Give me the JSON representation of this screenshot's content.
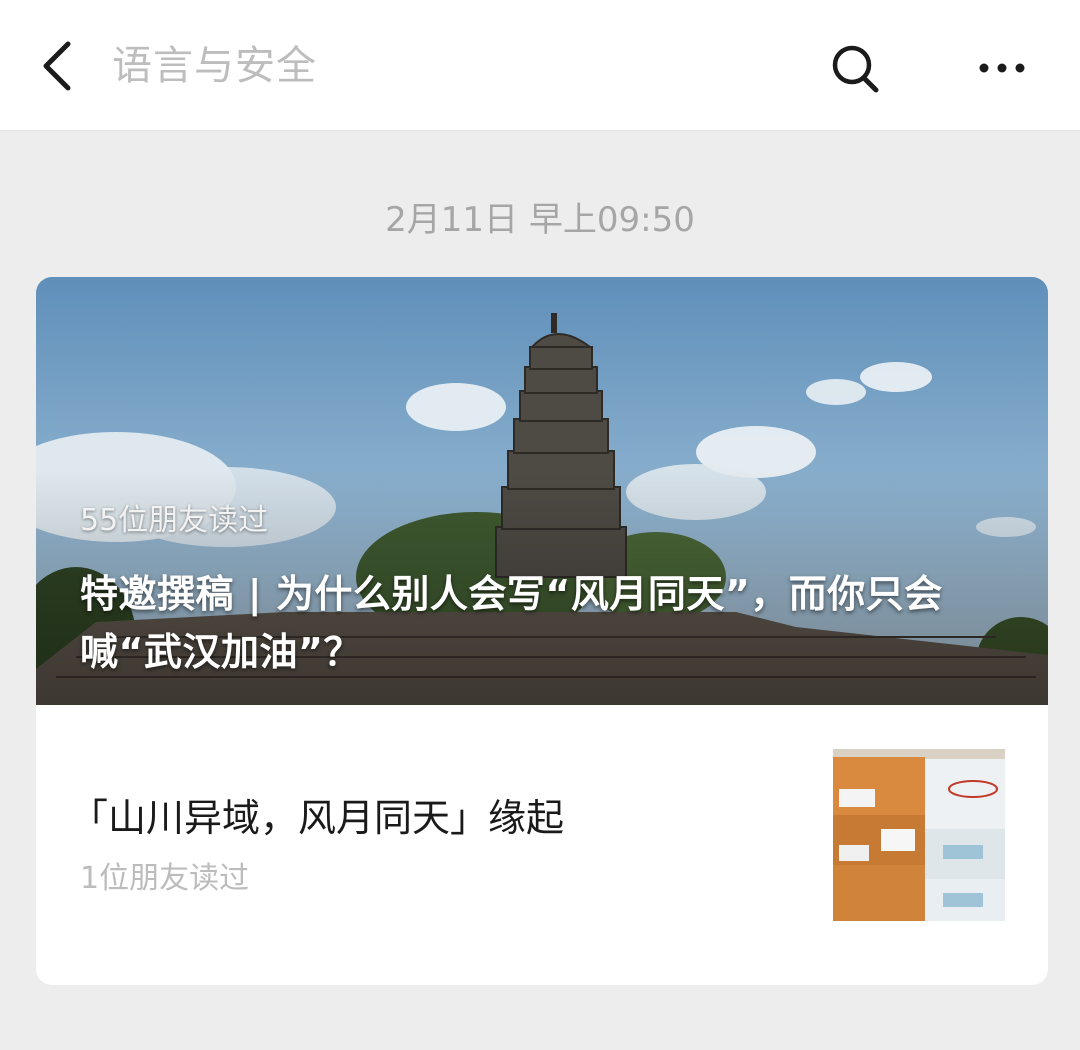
{
  "header": {
    "title": "语言与安全"
  },
  "message": {
    "timestamp": "2月11日 早上09:50"
  },
  "articles": [
    {
      "read_count": "55位朋友读过",
      "title": "特邀撰稿 | 为什么别人会写“风月同天”，而你只会喊“武汉加油”？"
    },
    {
      "title": "「山川异域，风月同天」缘起",
      "read_count": "1位朋友读过"
    }
  ],
  "icons": {
    "back": "chevron-left-icon",
    "search": "search-icon",
    "more": "more-dots-icon"
  },
  "colors": {
    "header_bg": "#ffffff",
    "page_bg": "#ededed",
    "title_gray": "#bdbdbd",
    "timestamp_gray": "#a6a6a6",
    "article_text": "#1a1a1a"
  }
}
